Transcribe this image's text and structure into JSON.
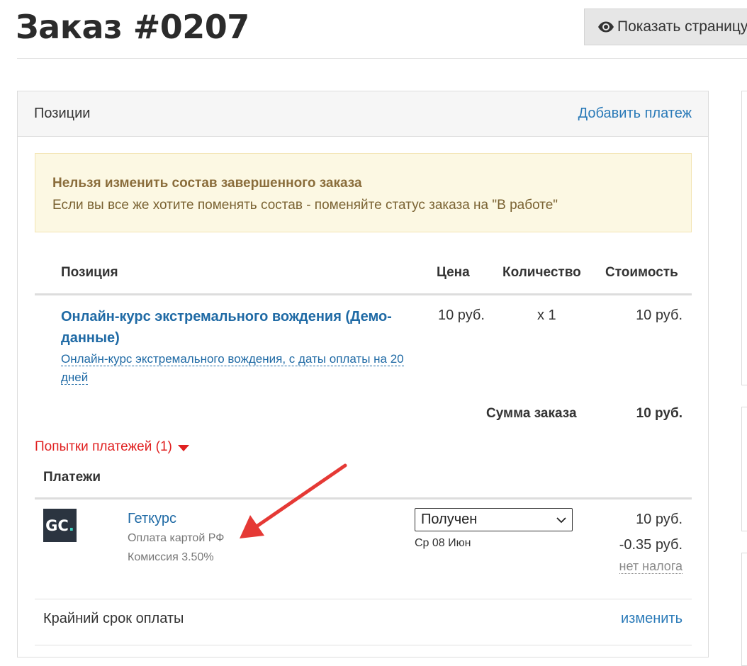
{
  "page": {
    "title": "Заказ #0207",
    "preview_button": "Показать страницу"
  },
  "panel": {
    "title": "Позиции",
    "add_payment": "Добавить платеж"
  },
  "alert": {
    "title": "Нельзя изменить состав завершенного заказа",
    "text": "Если вы все же хотите поменять состав - поменяйте статус заказа на \"В работе\""
  },
  "table": {
    "headers": {
      "position": "Позиция",
      "price": "Цена",
      "quantity": "Количество",
      "cost": "Стоимость"
    },
    "items": [
      {
        "title": "Онлайн-курс экстремального вождения (Демо-данные)",
        "subtitle": "Онлайн-курс экстремального вождения, с даты оплаты на 20 дней",
        "price": "10 руб.",
        "quantity": "x 1",
        "cost": "10 руб."
      }
    ],
    "total_label": "Сумма заказа",
    "total_value": "10 руб."
  },
  "attempts_label": "Попытки платежей (1)",
  "payments": {
    "title": "Платежи",
    "items": [
      {
        "logo_text": "GC",
        "logo_dot": ".",
        "gateway": "Геткурс",
        "method": "Оплата картой РФ",
        "fee": "Комиссия 3.50%",
        "status": "Получен",
        "date": "Ср 08 Июн",
        "amount": "10 руб.",
        "commission_amount": "-0.35 руб.",
        "tax": "нет налога"
      }
    ]
  },
  "deadline": {
    "label": "Крайний срок оплаты",
    "change": "изменить"
  },
  "colors": {
    "link": "#2a7ab8",
    "item_link": "#1f6aa5",
    "alert_bg": "#fcf8e3",
    "alert_text": "#8a6d3b",
    "attempts": "#e02020",
    "annotation_arrow": "#e53935"
  },
  "icons": {
    "preview": "eye-icon",
    "select": "chevron-down-icon",
    "attempts": "caret-down-icon"
  }
}
